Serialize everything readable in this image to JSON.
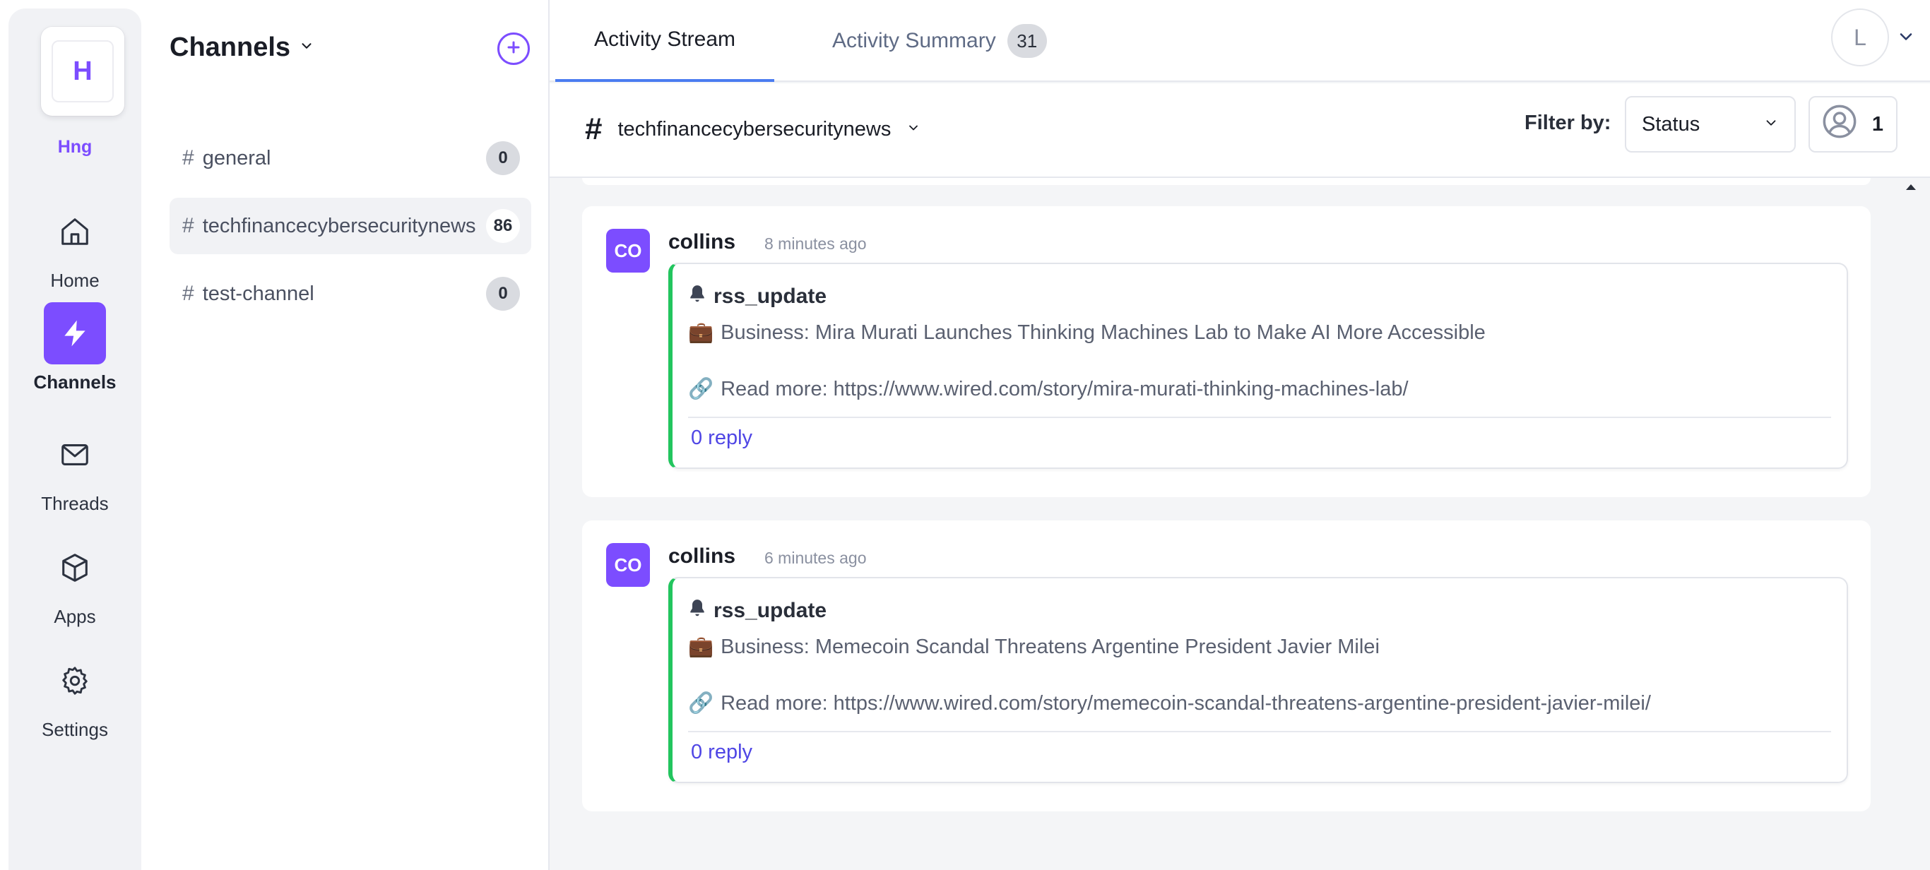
{
  "workspace": {
    "initial": "H",
    "name": "Hng"
  },
  "rail": {
    "items": [
      {
        "label": "Home",
        "icon": "home-icon"
      },
      {
        "label": "Channels",
        "icon": "lightning-icon"
      },
      {
        "label": "Threads",
        "icon": "mail-icon"
      },
      {
        "label": "Apps",
        "icon": "cube-icon"
      },
      {
        "label": "Settings",
        "icon": "gear-icon"
      }
    ],
    "active": "Channels"
  },
  "channels_panel": {
    "title": "Channels",
    "items": [
      {
        "hash": "#",
        "name": "general",
        "count": "0"
      },
      {
        "hash": "#",
        "name": "techfinancecybersecuritynews",
        "count": "86"
      },
      {
        "hash": "#",
        "name": "test-channel",
        "count": "0"
      }
    ]
  },
  "tabs": {
    "stream": "Activity Stream",
    "summary": "Activity Summary",
    "summary_count": "31"
  },
  "user": {
    "initial": "L"
  },
  "channel_bar": {
    "hash": "#",
    "channel": "techfinancecybersecuritynews",
    "filter_label": "Filter by:",
    "filter_value": "Status",
    "members_count": "1"
  },
  "messages": [
    {
      "avatar": "CO",
      "author": "collins",
      "time": "8 minutes ago",
      "type": "rss_update",
      "business_emoji": "💼",
      "business_text": "Business: Mira Murati Launches Thinking Machines Lab to Make AI More Accessible",
      "link_emoji": "🔗",
      "read_more": "Read more: https://www.wired.com/story/mira-murati-thinking-machines-lab/",
      "reply": "0 reply"
    },
    {
      "avatar": "CO",
      "author": "collins",
      "time": "6 minutes ago",
      "type": "rss_update",
      "business_emoji": "💼",
      "business_text": "Business: Memecoin Scandal Threatens Argentine President Javier Milei",
      "link_emoji": "🔗",
      "read_more": "Read more: https://www.wired.com/story/memecoin-scandal-threatens-argentine-president-javier-milei/",
      "reply": "0 reply"
    }
  ],
  "colors": {
    "accent": "#7c4dff",
    "message_stripe": "#22c55e",
    "link": "#4f46e5",
    "tab_underline": "#4a7cf0"
  }
}
